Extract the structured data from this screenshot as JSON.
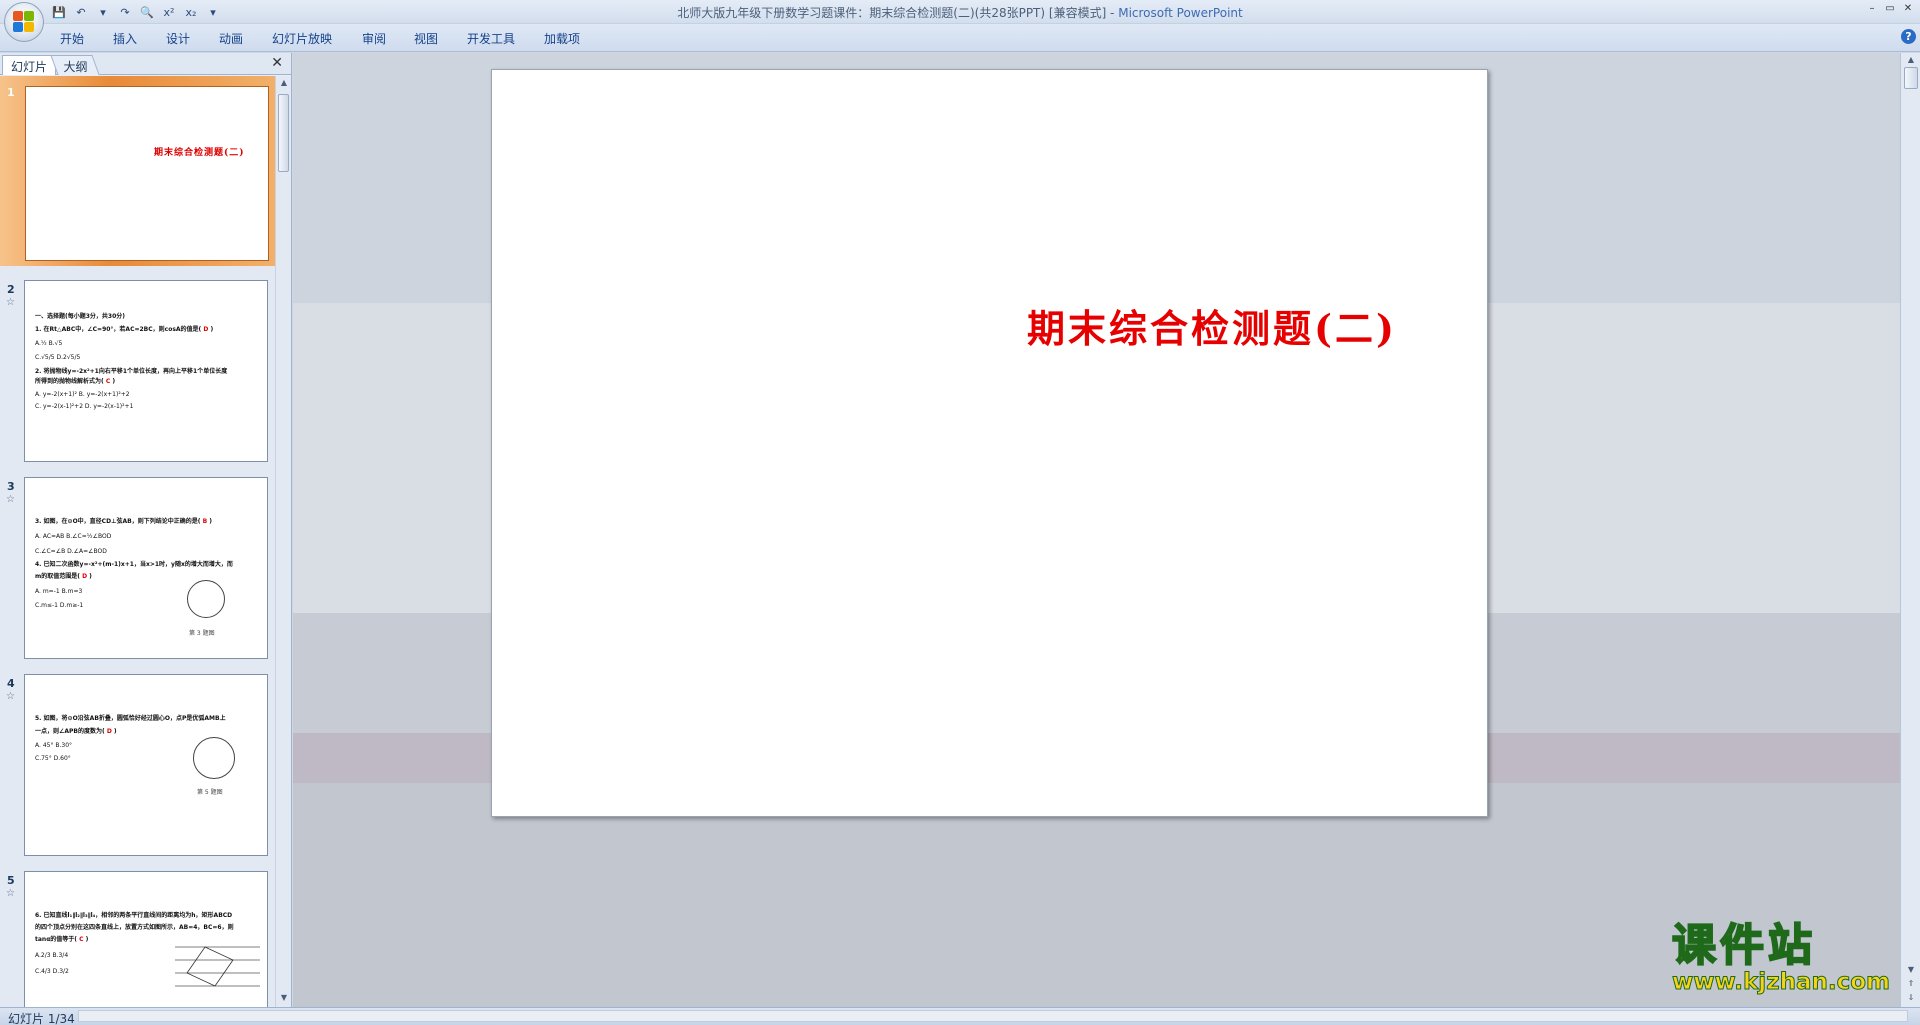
{
  "window": {
    "title": "北师大版九年级下册数学习题课件：期末综合检测题(二)(共28张PPT) [兼容模式] - ",
    "app_name": "Microsoft PowerPoint",
    "controls": [
      "–",
      "▭",
      "✕"
    ]
  },
  "quick_access": {
    "items": [
      {
        "name": "save-icon",
        "glyph": "💾"
      },
      {
        "name": "undo-icon",
        "glyph": "↶"
      },
      {
        "name": "undo-dropdown-icon",
        "glyph": "▾"
      },
      {
        "name": "redo-icon",
        "glyph": "↷"
      },
      {
        "name": "print-preview-icon",
        "glyph": "🔍"
      },
      {
        "name": "superscript-icon",
        "glyph": "x²"
      },
      {
        "name": "subscript-icon",
        "glyph": "x₂"
      },
      {
        "name": "customize-qat-icon",
        "glyph": "▾"
      }
    ]
  },
  "ribbon": {
    "tabs": [
      "开始",
      "插入",
      "设计",
      "动画",
      "幻灯片放映",
      "审阅",
      "视图",
      "开发工具",
      "加载项"
    ],
    "help": "?"
  },
  "left_pane": {
    "tab_slides": "幻灯片",
    "tab_outline": "大纲",
    "close": "✕",
    "thumbnails": [
      {
        "num": "1",
        "title": "期末综合检测题(二)"
      },
      {
        "num": "2",
        "lines": [
          "一、选择题(每小题3分，共30分)",
          "1. 在Rt△ABC中，∠C=90°，若AC=2BC，则cosA的值是(",
          "A.½                                   B.√5",
          "C.√5/5                              D.2√5/5",
          "2. 将抛物线y=-2x²+1向右平移1个单位长度，再向上平移1个单位长度",
          "所得到的抛物线解析式为(",
          "A. y=-2(x+1)²                    B. y=-2(x+1)²+2",
          "C. y=-2(x-1)²+2                D. y=-2(x-1)²+1"
        ],
        "answers": [
          "D",
          "C"
        ]
      },
      {
        "num": "3",
        "lines": [
          "3. 如图，在⊙O中，直径CD⊥弦AB，则下列结论中正确的是(",
          "A. AC=AB                         B.∠C=½∠BOD",
          "C.∠C=∠B                          D.∠A=∠BOD",
          "4. 已知二次函数y=-x²+(m-1)x+1，当x>1时，y随x的增大而增大，而",
          "m的取值范围是(",
          "A. m=-1                            B.m=3",
          "C.m≤-1                             D.m≥-1"
        ],
        "answers": [
          "B",
          "D"
        ],
        "caption": "第 3 题图"
      },
      {
        "num": "4",
        "lines": [
          "5. 如图，将⊙O沿弦AB折叠，圆弧恰好经过圆心O，点P是优弧AMB上",
          "一点，则∠APB的度数为(",
          "A. 45°                               B.30°",
          "C.75°                                D.60°"
        ],
        "answers": [
          "D"
        ],
        "caption": "第 5 题图"
      },
      {
        "num": "5",
        "lines": [
          "6. 已知直线l₁∥l₂∥l₃∥l₄，相邻的两条平行直线间的距离均为h，矩形ABCD",
          "的四个顶点分别在这四条直线上，放置方式如图所示，AB=4，BC=6，则",
          "tanα的值等于(",
          "A.2/3                                  B.3/4",
          "C.4/3                                  D.3/2"
        ],
        "answers": [
          "C"
        ]
      }
    ]
  },
  "slide": {
    "title": "期末综合检测题(二)"
  },
  "watermark": {
    "brand": "课件站",
    "url": "www.kjzhan.com"
  },
  "status": {
    "text": "幻灯片 1/34"
  },
  "colors": {
    "slide_title": "#e60000",
    "selected_thumb": "#e88a38",
    "watermark_fill": "#f7d21a",
    "watermark_stroke": "#1f6a1a"
  }
}
